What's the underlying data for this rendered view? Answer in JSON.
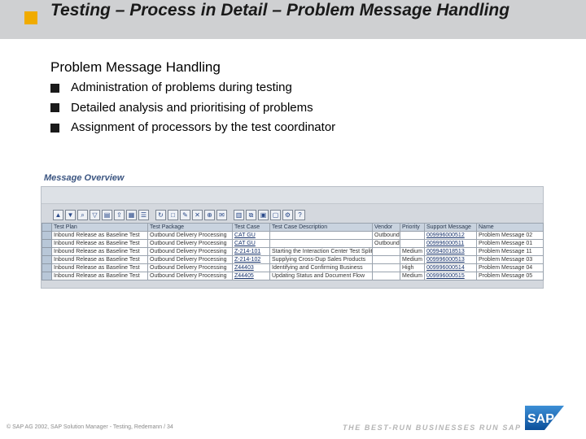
{
  "slide": {
    "title": "Testing – Process in Detail – Problem Message Handling",
    "heading": "Problem Message Handling",
    "bullets": [
      "Administration of problems during testing",
      "Detailed analysis and prioritising of problems",
      "Assignment of processors by the test coordinator"
    ]
  },
  "screenshot": {
    "label": "Message Overview",
    "columns": [
      "Test Plan",
      "Test Package",
      "Test Case",
      "Test Case Description",
      "Vendor",
      "Priority",
      "Support Message",
      "Name"
    ],
    "rows": [
      [
        "Inbound Release as Baseline Test",
        "Outbound Delivery Processing",
        "CAT GU",
        "",
        "Outbound",
        "",
        "009996000512",
        "Problem Message 02"
      ],
      [
        "Inbound Release as Baseline Test",
        "Outbound Delivery Processing",
        "CAT GU",
        "",
        "Outbound",
        "",
        "009996000511",
        "Problem Message 01"
      ],
      [
        "Inbound Release as Baseline Test",
        "Outbound Delivery Processing",
        "Z-214-101",
        "Starting the Interaction Center Test Split",
        "",
        "Medium",
        "009940018513",
        "Problem Message 11"
      ],
      [
        "Inbound Release as Baseline Test",
        "Outbound Delivery Processing",
        "Z-214-102",
        "Supplying Cross-Dup Sales Products",
        "",
        "Medium",
        "009996000513",
        "Problem Message 03"
      ],
      [
        "Inbound Release as Baseline Test",
        "Outbound Delivery Processing",
        "Z44403",
        "Identifying and Confirming Business",
        "",
        "High",
        "009996000514",
        "Problem Message 04"
      ],
      [
        "Inbound Release as Baseline Test",
        "Outbound Delivery Processing",
        "Z44405",
        "Updating Status and Document Flow",
        "",
        "Medium",
        "009996000515",
        "Problem Message 05"
      ]
    ],
    "toolbar_icons": [
      "sort-ascending-icon",
      "sort-descending-icon",
      "find-icon",
      "filter-icon",
      "print-icon",
      "export-icon",
      "layout-icon",
      "detail-icon",
      "refresh-icon",
      "create-icon",
      "edit-icon",
      "delete-icon",
      "attach-icon",
      "mail-icon",
      "graphic-icon",
      "copy-icon",
      "select-all-icon",
      "deselect-icon",
      "settings-icon",
      "help-icon"
    ]
  },
  "footer": {
    "copyright": "© SAP AG 2002, SAP Solution Manager - Testing, Redemann / 34",
    "slogan": "THE BEST-RUN BUSINESSES RUN SAP",
    "logo_text": "SAP"
  },
  "colors": {
    "accent": "#f0ab00",
    "title_band": "#cfd0d2",
    "logo_blue": "#1d6ab6"
  }
}
